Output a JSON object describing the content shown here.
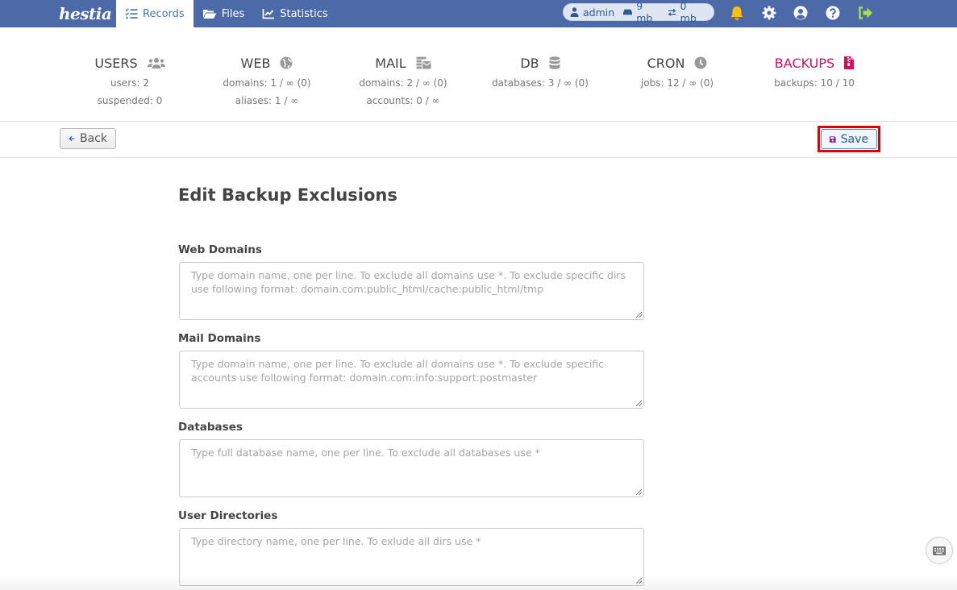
{
  "header": {
    "logo_text": "hestia",
    "nav": [
      {
        "label": "Records",
        "icon": "list-check-icon",
        "active": true
      },
      {
        "label": "Files",
        "icon": "folder-open-icon",
        "active": false
      },
      {
        "label": "Statistics",
        "icon": "chart-line-icon",
        "active": false
      }
    ],
    "user": {
      "name": "admin",
      "disk": "9 mb",
      "bandwidth": "0 mb"
    },
    "icons": [
      "bell-icon",
      "gear-icon",
      "user-circle-icon",
      "help-icon",
      "logout-icon"
    ],
    "colors": {
      "bar": "#4c6aa7",
      "bell": "#ffc107",
      "logout": "#a7e04c",
      "active_stat": "#d1105a"
    }
  },
  "stats": [
    {
      "title": "USERS",
      "icon": "users-icon",
      "lines": [
        "users: 2",
        "suspended: 0"
      ],
      "active": false
    },
    {
      "title": "WEB",
      "icon": "globe-icon",
      "lines": [
        "domains: 1 / ∞ (0)",
        "aliases: 1 / ∞"
      ],
      "active": false
    },
    {
      "title": "MAIL",
      "icon": "mail-bulk-icon",
      "lines": [
        "domains: 2 / ∞ (0)",
        "accounts: 0 / ∞"
      ],
      "active": false
    },
    {
      "title": "DB",
      "icon": "database-icon",
      "lines": [
        "databases: 3 / ∞ (0)"
      ],
      "active": false
    },
    {
      "title": "CRON",
      "icon": "clock-icon",
      "lines": [
        "jobs: 12 / ∞ (0)"
      ],
      "active": false
    },
    {
      "title": "BACKUPS",
      "icon": "file-archive-icon",
      "lines": [
        "backups: 10 / 10"
      ],
      "active": true
    }
  ],
  "toolbar": {
    "back_label": "Back",
    "save_label": "Save"
  },
  "form": {
    "title": "Edit Backup Exclusions",
    "fields": [
      {
        "label": "Web Domains",
        "value": "",
        "placeholder": "Type domain name, one per line. To exclude all domains use *. To exclude specific dirs use following format: domain.com:public_html/cache:public_html/tmp"
      },
      {
        "label": "Mail Domains",
        "value": "",
        "placeholder": "Type domain name, one per line. To exclude all domains use *. To exclude specific accounts use following format: domain.com:info:support:postmaster"
      },
      {
        "label": "Databases",
        "value": "",
        "placeholder": "Type full database name, one per line. To exclude all databases use *"
      },
      {
        "label": "User Directories",
        "value": "",
        "placeholder": "Type directory name, one per line. To exlude all dirs use *"
      }
    ]
  }
}
